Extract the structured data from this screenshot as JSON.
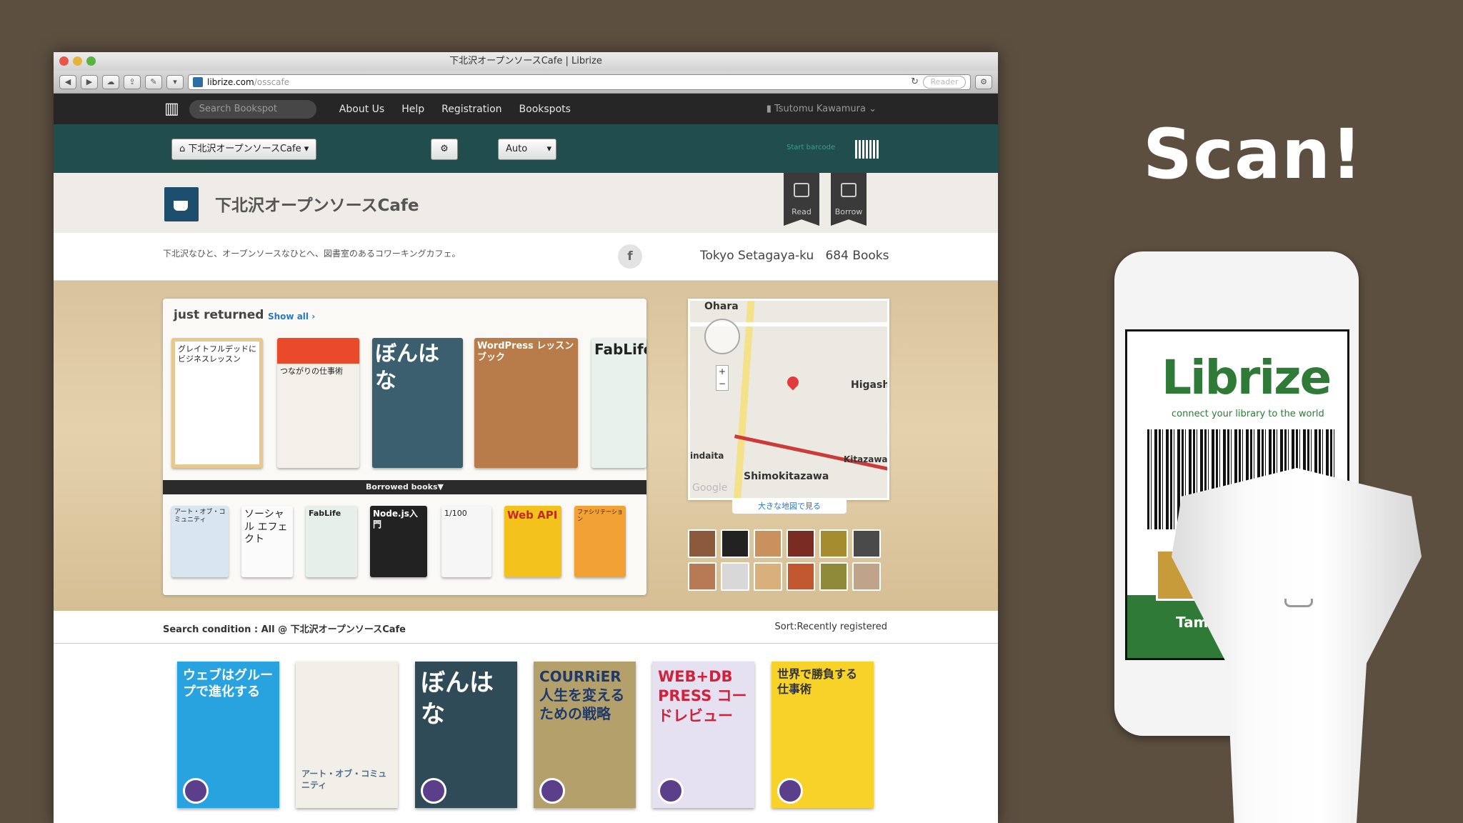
{
  "browser": {
    "title": "下北沢オープンソースCafe | Librize",
    "url_domain": "librize.com",
    "url_path": "/osscafe",
    "reader_label": "Reader"
  },
  "nav": {
    "search_placeholder": "Search Bookspot",
    "links": [
      "About Us",
      "Help",
      "Registration",
      "Bookspots"
    ],
    "user": "Tsutomu Kawamura"
  },
  "subbar": {
    "spot_select": "下北沢オープンソースCafe",
    "mode_select": "Auto",
    "scan_label": "Start barcode"
  },
  "library": {
    "title": "下北沢オープンソースCafe",
    "read_label": "Read",
    "borrow_label": "Borrow",
    "description": "下北沢なひと、オープンソースなひとへ、図書室のあるコワーキングカフェ。",
    "facebook": "f",
    "location": "Tokyo Setagaya-ku",
    "book_count": "684 Books"
  },
  "shelf": {
    "heading": "just returned",
    "show_all": "Show all",
    "returned_books": [
      "グレイトフルデッドにビジネスレッスン",
      "つながりの仕事術",
      "ぼんはな",
      "WordPress レッスンブック",
      "FabLife"
    ],
    "borrowed_label": "Borrowed books",
    "borrowed_books": [
      "アート・オブ・コミュニティ",
      "ソーシャル エフェクト",
      "FabLife",
      "Node.js入門",
      "1/100",
      "Web API",
      "ファシリテーション"
    ]
  },
  "map": {
    "labels": [
      "Ohara",
      "Higash",
      "Kitazawa",
      "Shimokitazawa",
      "indaita",
      "Google"
    ],
    "link": "大きな地図で見る"
  },
  "search": {
    "condition": "Search condition : All @ 下北沢オープンソースCafe",
    "sort": "Sort:Recently registered",
    "books": [
      "ウェブはグループで進化する",
      "アート・オブ・コミュニティ",
      "ぼんはな",
      "COURRiER 人生を変えるための戦略",
      "WEB+DB PRESS コードレビュー",
      "世界で勝負する仕事術"
    ]
  },
  "slide": {
    "headline": "Scan!",
    "app_name": "Librize",
    "tagline": "connect your library to the world",
    "user_name": "Tama"
  }
}
